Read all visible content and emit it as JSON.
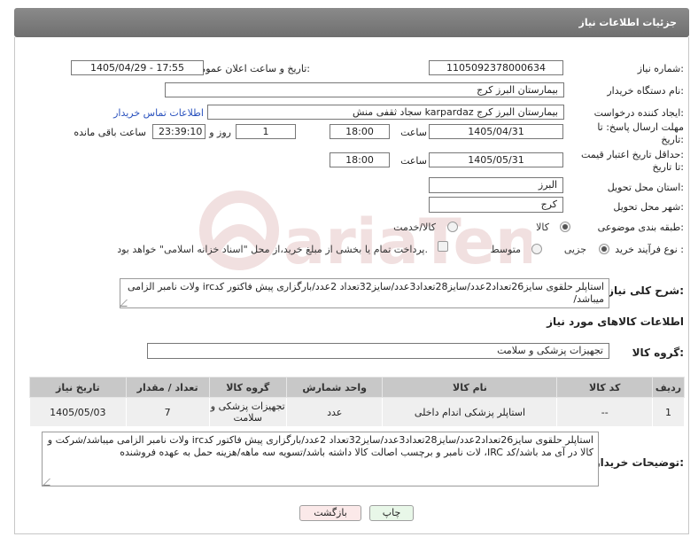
{
  "header": {
    "title": "جزئیات اطلاعات نیاز"
  },
  "fields": {
    "need_number": {
      "label": "شماره نیاز:",
      "value": "1105092378000634"
    },
    "announce_datetime": {
      "label": "تاریخ و ساعت اعلان عمومی:",
      "value": "1405/04/29 - 17:55"
    },
    "buyer_org": {
      "label": "نام دستگاه خریدار:",
      "value": "بیمارستان البرز کرج"
    },
    "requester": {
      "label": "ایجاد کننده درخواست:",
      "value": "سجاد ثقفی منش karpardaz بیمارستان البرز کرج",
      "contact_link": "اطلاعات تماس خریدار"
    },
    "reply_deadline": {
      "label_line1": "مهلت ارسال پاسخ: تا",
      "label_line2": "تاریخ:",
      "date": "1405/04/31",
      "time_label": "ساعت",
      "time": "18:00",
      "days": "1",
      "days_label": "روز و",
      "remaining": "23:39:10",
      "remaining_label": "ساعت باقی مانده"
    },
    "price_validity": {
      "label_line1": "حداقل تاریخ اعتبار قیمت:",
      "label_line2": "تا تاریخ:",
      "date": "1405/05/31",
      "time_label": "ساعت",
      "time": "18:00"
    },
    "delivery_province": {
      "label": "استان محل تحویل:",
      "value": "البرز"
    },
    "delivery_city": {
      "label": "شهر محل تحویل:",
      "value": "کرج"
    },
    "category": {
      "label": "طبقه بندی موضوعی:",
      "options": [
        "کالا",
        "کالا/خدمت"
      ],
      "selected": "کالا"
    },
    "purchase_process": {
      "label": "نوع فرآیند خرید :",
      "options": [
        "جزیی",
        "متوسط"
      ],
      "selected": "جزیی",
      "payment_note": "پرداخت تمام یا بخشی از مبلغ خرید،از محل \"اسناد خزانه اسلامی\" خواهد بود."
    }
  },
  "need_description": {
    "label": "شرح کلی نیاز:",
    "text": "استاپلر حلقوی سایز26تعداد2عدد/سایز28تعداد3عدد/سایز32تعداد 2عدد/بارگزاری پیش فاکتور کدirc ولات نامبر الزامی میباشد/"
  },
  "goods_section": {
    "title": "اطلاعات کالاهای مورد نیاز"
  },
  "goods_group": {
    "label": "گروه کالا:",
    "value": "تجهیزات پزشکی و سلامت"
  },
  "items_table": {
    "headers": [
      "ردیف",
      "کد کالا",
      "نام کالا",
      "واحد شمارش",
      "گروه کالا",
      "تعداد / مقدار",
      "تاریخ نیاز"
    ],
    "rows": [
      [
        "1",
        "--",
        "استاپلر پزشکی اندام داخلی",
        "عدد",
        "تجهیزات پزشکی و سلامت",
        "7",
        "1405/05/03"
      ]
    ]
  },
  "buyer_notes": {
    "label": "توضیحات خریدار:",
    "text": "استاپلر حلقوی سایز26تعداد2عدد/سایز28تعداد3عدد/سایز32تعداد 2عدد/بارگزاری پیش فاکتور کدirc ولات نامبر الزامی میباشد/شرکت و کالا در آی مد باشد/کد IRC، لات نامبر و برچسب اصالت کالا داشته باشد/تسویه سه ماهه/هزینه حمل به عهده فروشنده"
  },
  "buttons": {
    "print": "چاپ",
    "back": "بازگشت"
  },
  "colors": {
    "header_bg": "#7a7a7a",
    "link": "#2a52be",
    "print_btn_bg": "#e8f7e8",
    "back_btn_bg": "#fbe9e9"
  }
}
